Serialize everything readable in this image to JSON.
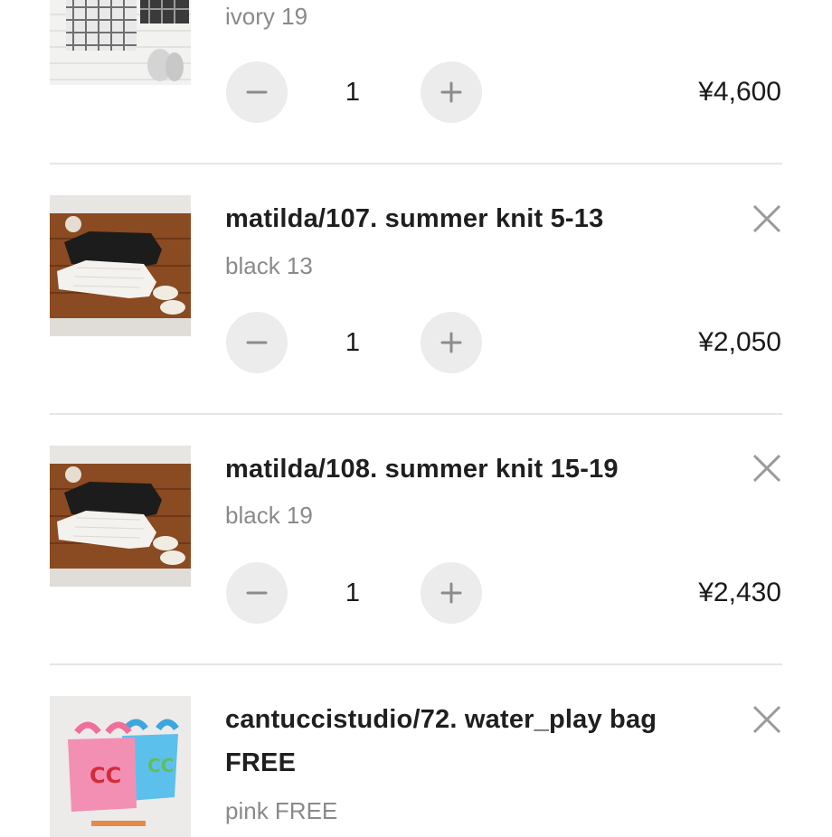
{
  "cart": {
    "items": [
      {
        "title": "",
        "variant": "ivory 19",
        "quantity": "1",
        "price": "¥4,600",
        "thumbnail_icon": "plaid-shirt-photo"
      },
      {
        "title": "matilda/107. summer knit 5-13",
        "variant": "black 13",
        "quantity": "1",
        "price": "¥2,050",
        "thumbnail_icon": "knit-tops-photo"
      },
      {
        "title": "matilda/108. summer knit 15-19",
        "variant": "black 19",
        "quantity": "1",
        "price": "¥2,430",
        "thumbnail_icon": "knit-tops-photo"
      },
      {
        "title_line1": "cantuccistudio/72. water_play bag",
        "title_line2": "FREE",
        "variant": "pink FREE",
        "thumbnail_icon": "tote-bags-photo"
      }
    ]
  },
  "colors": {
    "stepper_bg": "#ececec",
    "divider": "#e6e6e6",
    "muted_text": "#8a8a8a"
  }
}
